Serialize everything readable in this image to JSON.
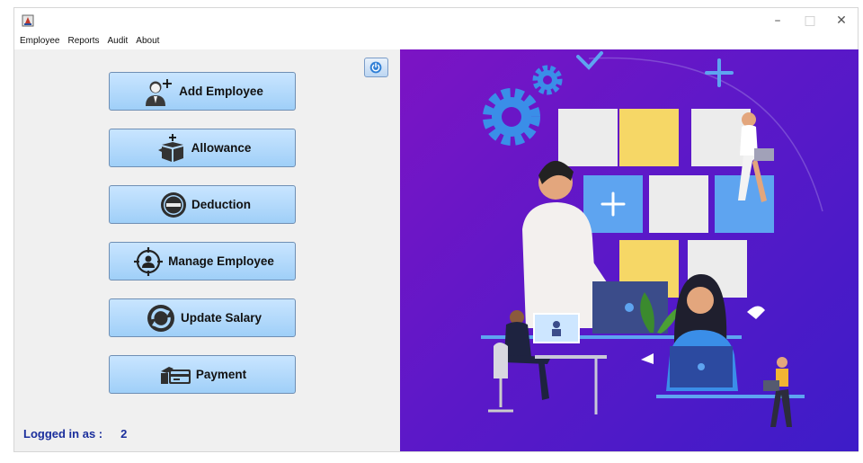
{
  "menubar": {
    "items": [
      "Employee",
      "Reports",
      "Audit",
      "About"
    ]
  },
  "window_controls": {
    "minimize": "–",
    "maximize": "□",
    "close": "✕"
  },
  "buttons": [
    {
      "label": "Add Employee",
      "icon": "add-user-icon"
    },
    {
      "label": "Allowance",
      "icon": "gift-box-icon"
    },
    {
      "label": "Deduction",
      "icon": "minus-circle-icon"
    },
    {
      "label": "Manage Employee",
      "icon": "target-user-icon"
    },
    {
      "label": "Update Salary",
      "icon": "refresh-icon"
    },
    {
      "label": "Payment",
      "icon": "card-hand-icon"
    }
  ],
  "status": {
    "logged_label": "Logged in as :",
    "user_id": "2"
  },
  "colors": {
    "accent_blue": "#1a2e9c",
    "button_fill": "#a9d6fb",
    "hero_purple": "#6a16c6"
  }
}
